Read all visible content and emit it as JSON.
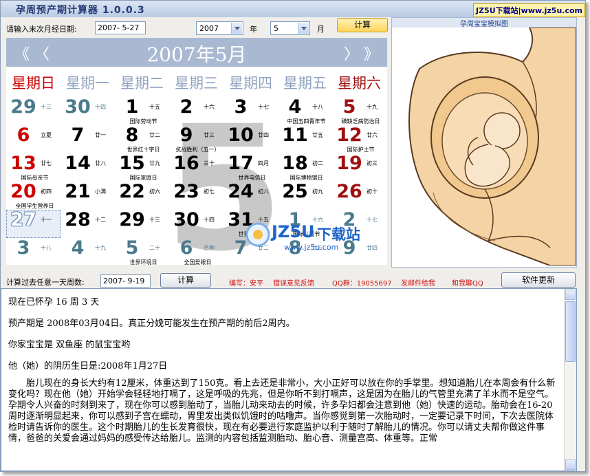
{
  "window": {
    "title": "孕周预产期计算器  1.0.0.3",
    "watermark_badge": "JZ5U下载站|www.jz5u.com"
  },
  "inputs": {
    "last_period_label": "请输入末次月经日期:",
    "last_period_value": "2007- 5-27",
    "year_value": "2007",
    "year_label": "年",
    "month_value": "5",
    "month_label": "月",
    "calc_button": "计算"
  },
  "calendar": {
    "title": "2007年5月",
    "nav_prev": "《 〈",
    "nav_next": "〉 》",
    "watermark_month": "5",
    "weekdays": [
      "星期日",
      "星期一",
      "星期二",
      "星期三",
      "星期四",
      "星期五",
      "星期六"
    ],
    "rows": [
      [
        {
          "d": "29",
          "l": "十三",
          "f": ""
        },
        {
          "d": "30",
          "l": "十四",
          "f": ""
        },
        {
          "d": "1",
          "l": "十五",
          "f": "国际劳动节"
        },
        {
          "d": "2",
          "l": "十六",
          "f": ""
        },
        {
          "d": "3",
          "l": "十七",
          "f": ""
        },
        {
          "d": "4",
          "l": "十八",
          "f": "中国五四青年节"
        },
        {
          "d": "5",
          "l": "十九",
          "f": "碘缺乏病防治日"
        }
      ],
      [
        {
          "d": "6",
          "l": "立夏",
          "f": ""
        },
        {
          "d": "7",
          "l": "廿一",
          "f": ""
        },
        {
          "d": "8",
          "l": "廿二",
          "f": "世界红十字日"
        },
        {
          "d": "9",
          "l": "廿三",
          "f": "抗战胜利（五一）"
        },
        {
          "d": "10",
          "l": "廿四",
          "f": ""
        },
        {
          "d": "11",
          "l": "廿五",
          "f": ""
        },
        {
          "d": "12",
          "l": "廿六",
          "f": "国际护士节"
        }
      ],
      [
        {
          "d": "13",
          "l": "廿七",
          "f": "国际母亲节"
        },
        {
          "d": "14",
          "l": "廿八",
          "f": ""
        },
        {
          "d": "15",
          "l": "廿九",
          "f": "国际家庭日"
        },
        {
          "d": "16",
          "l": "三十",
          "f": ""
        },
        {
          "d": "17",
          "l": "四月",
          "f": "世界电信日"
        },
        {
          "d": "18",
          "l": "初二",
          "f": "国际博物馆日"
        },
        {
          "d": "19",
          "l": "初三",
          "f": ""
        }
      ],
      [
        {
          "d": "20",
          "l": "初四",
          "f": "全国学生营养日"
        },
        {
          "d": "21",
          "l": "小满",
          "f": ""
        },
        {
          "d": "22",
          "l": "初六",
          "f": ""
        },
        {
          "d": "23",
          "l": "初七",
          "f": ""
        },
        {
          "d": "24",
          "l": "初八",
          "f": ""
        },
        {
          "d": "25",
          "l": "初九",
          "f": ""
        },
        {
          "d": "26",
          "l": "初十",
          "f": ""
        }
      ],
      [
        {
          "d": "27",
          "l": "十一",
          "f": ""
        },
        {
          "d": "28",
          "l": "十二",
          "f": ""
        },
        {
          "d": "29",
          "l": "十三",
          "f": ""
        },
        {
          "d": "30",
          "l": "十四",
          "f": ""
        },
        {
          "d": "31",
          "l": "十五",
          "f": "世界无烟日"
        },
        {
          "d": "1",
          "l": "十六",
          "f": "国际儿童节"
        },
        {
          "d": "2",
          "l": "十七",
          "f": ""
        }
      ],
      [
        {
          "d": "3",
          "l": "十八",
          "f": ""
        },
        {
          "d": "4",
          "l": "十九",
          "f": ""
        },
        {
          "d": "5",
          "l": "二十",
          "f": "世界环境日"
        },
        {
          "d": "6",
          "l": "芒种",
          "f": "全国爱眼日"
        },
        {
          "d": "7",
          "l": "廿二",
          "f": ""
        },
        {
          "d": "8",
          "l": "廿三",
          "f": ""
        },
        {
          "d": "9",
          "l": "廿四",
          "f": ""
        }
      ]
    ]
  },
  "picture": {
    "caption": "孕周宝宝模拟图"
  },
  "watermark": {
    "logo_text": "JZ5U",
    "logo_sub": "下载站",
    "url": "www.jz5u.com"
  },
  "week_calc": {
    "label": "计算过去任意一天周数:",
    "value": "2007- 9-19",
    "button": "计算",
    "author": "编写：安平",
    "feedback": "错误意见反馈",
    "qq_group": "QQ群：19055697",
    "send_mail": "发邮件给我",
    "chat_qq": "和我聊QQ",
    "update_button": "软件更新"
  },
  "result": {
    "line1": "现在已怀孕 16 周 3 天",
    "line2": "预产期是 2008年03月04日。真正分娩可能发生在预产期的前后2周内。",
    "line3": "你家宝宝是 双鱼座 的鼠宝宝哟",
    "line4": "他（她）的阴历生日是:2008年1月27日",
    "paragraph": "胎儿现在的身长大约有12厘米，体重达到了150克。看上去还是非常小，大小正好可以放在你的手掌里。想知道胎儿在本周会有什么新变化吗？现在他（她）开始学会轻轻地打嗝了，这是呼吸的先兆，但是你听不到打嗝声，这是因为在胎儿的气管里充满了羊水而不是空气。孕期令人兴奋的时刻到来了，现在你可以感到胎动了，当胎儿动来动去的时候，许多孕妇都会注意到他（她）快速的运动。胎动会在16-20周时逐渐明显起来，你可以感到子宫在蠕动，胃里发出类似饥饿时的咕噜声。当你感觉到第一次胎动时，一定要记录下时间，下次去医院体检时请告诉你的医生。这个时期胎儿的生长发育很快，现在有必要进行家庭监护以利于随时了解胎儿的情况。你可以请丈夫帮你做这件事情，爸爸的关爱会通过妈妈的感受传达给胎儿。监测的内容包括监测胎动、胎心音、测量宫高、体重等。正常"
  },
  "colors": {
    "sunday_red": "#cc0000",
    "saturday_red": "#a01010",
    "adjacent_month": "#4a7a8c",
    "header_blue": "#a9b9d2"
  }
}
